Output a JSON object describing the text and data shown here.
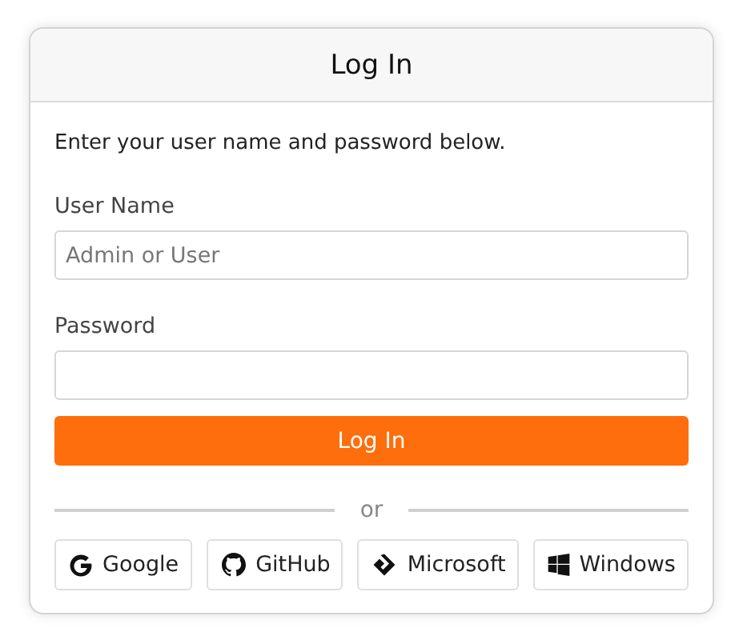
{
  "dialog": {
    "title": "Log In"
  },
  "instructions": "Enter your user name and password below.",
  "fields": [
    {
      "label": "User Name",
      "placeholder": "Admin or User"
    },
    {
      "label": "Password"
    }
  ],
  "submit": "Log In",
  "separator": "or",
  "providers": [
    {
      "kind": "google",
      "label": "Google"
    },
    {
      "kind": "github",
      "label": "GitHub"
    },
    {
      "kind": "microsoft",
      "label": "Microsoft"
    },
    {
      "kind": "windows",
      "label": "Windows"
    }
  ]
}
